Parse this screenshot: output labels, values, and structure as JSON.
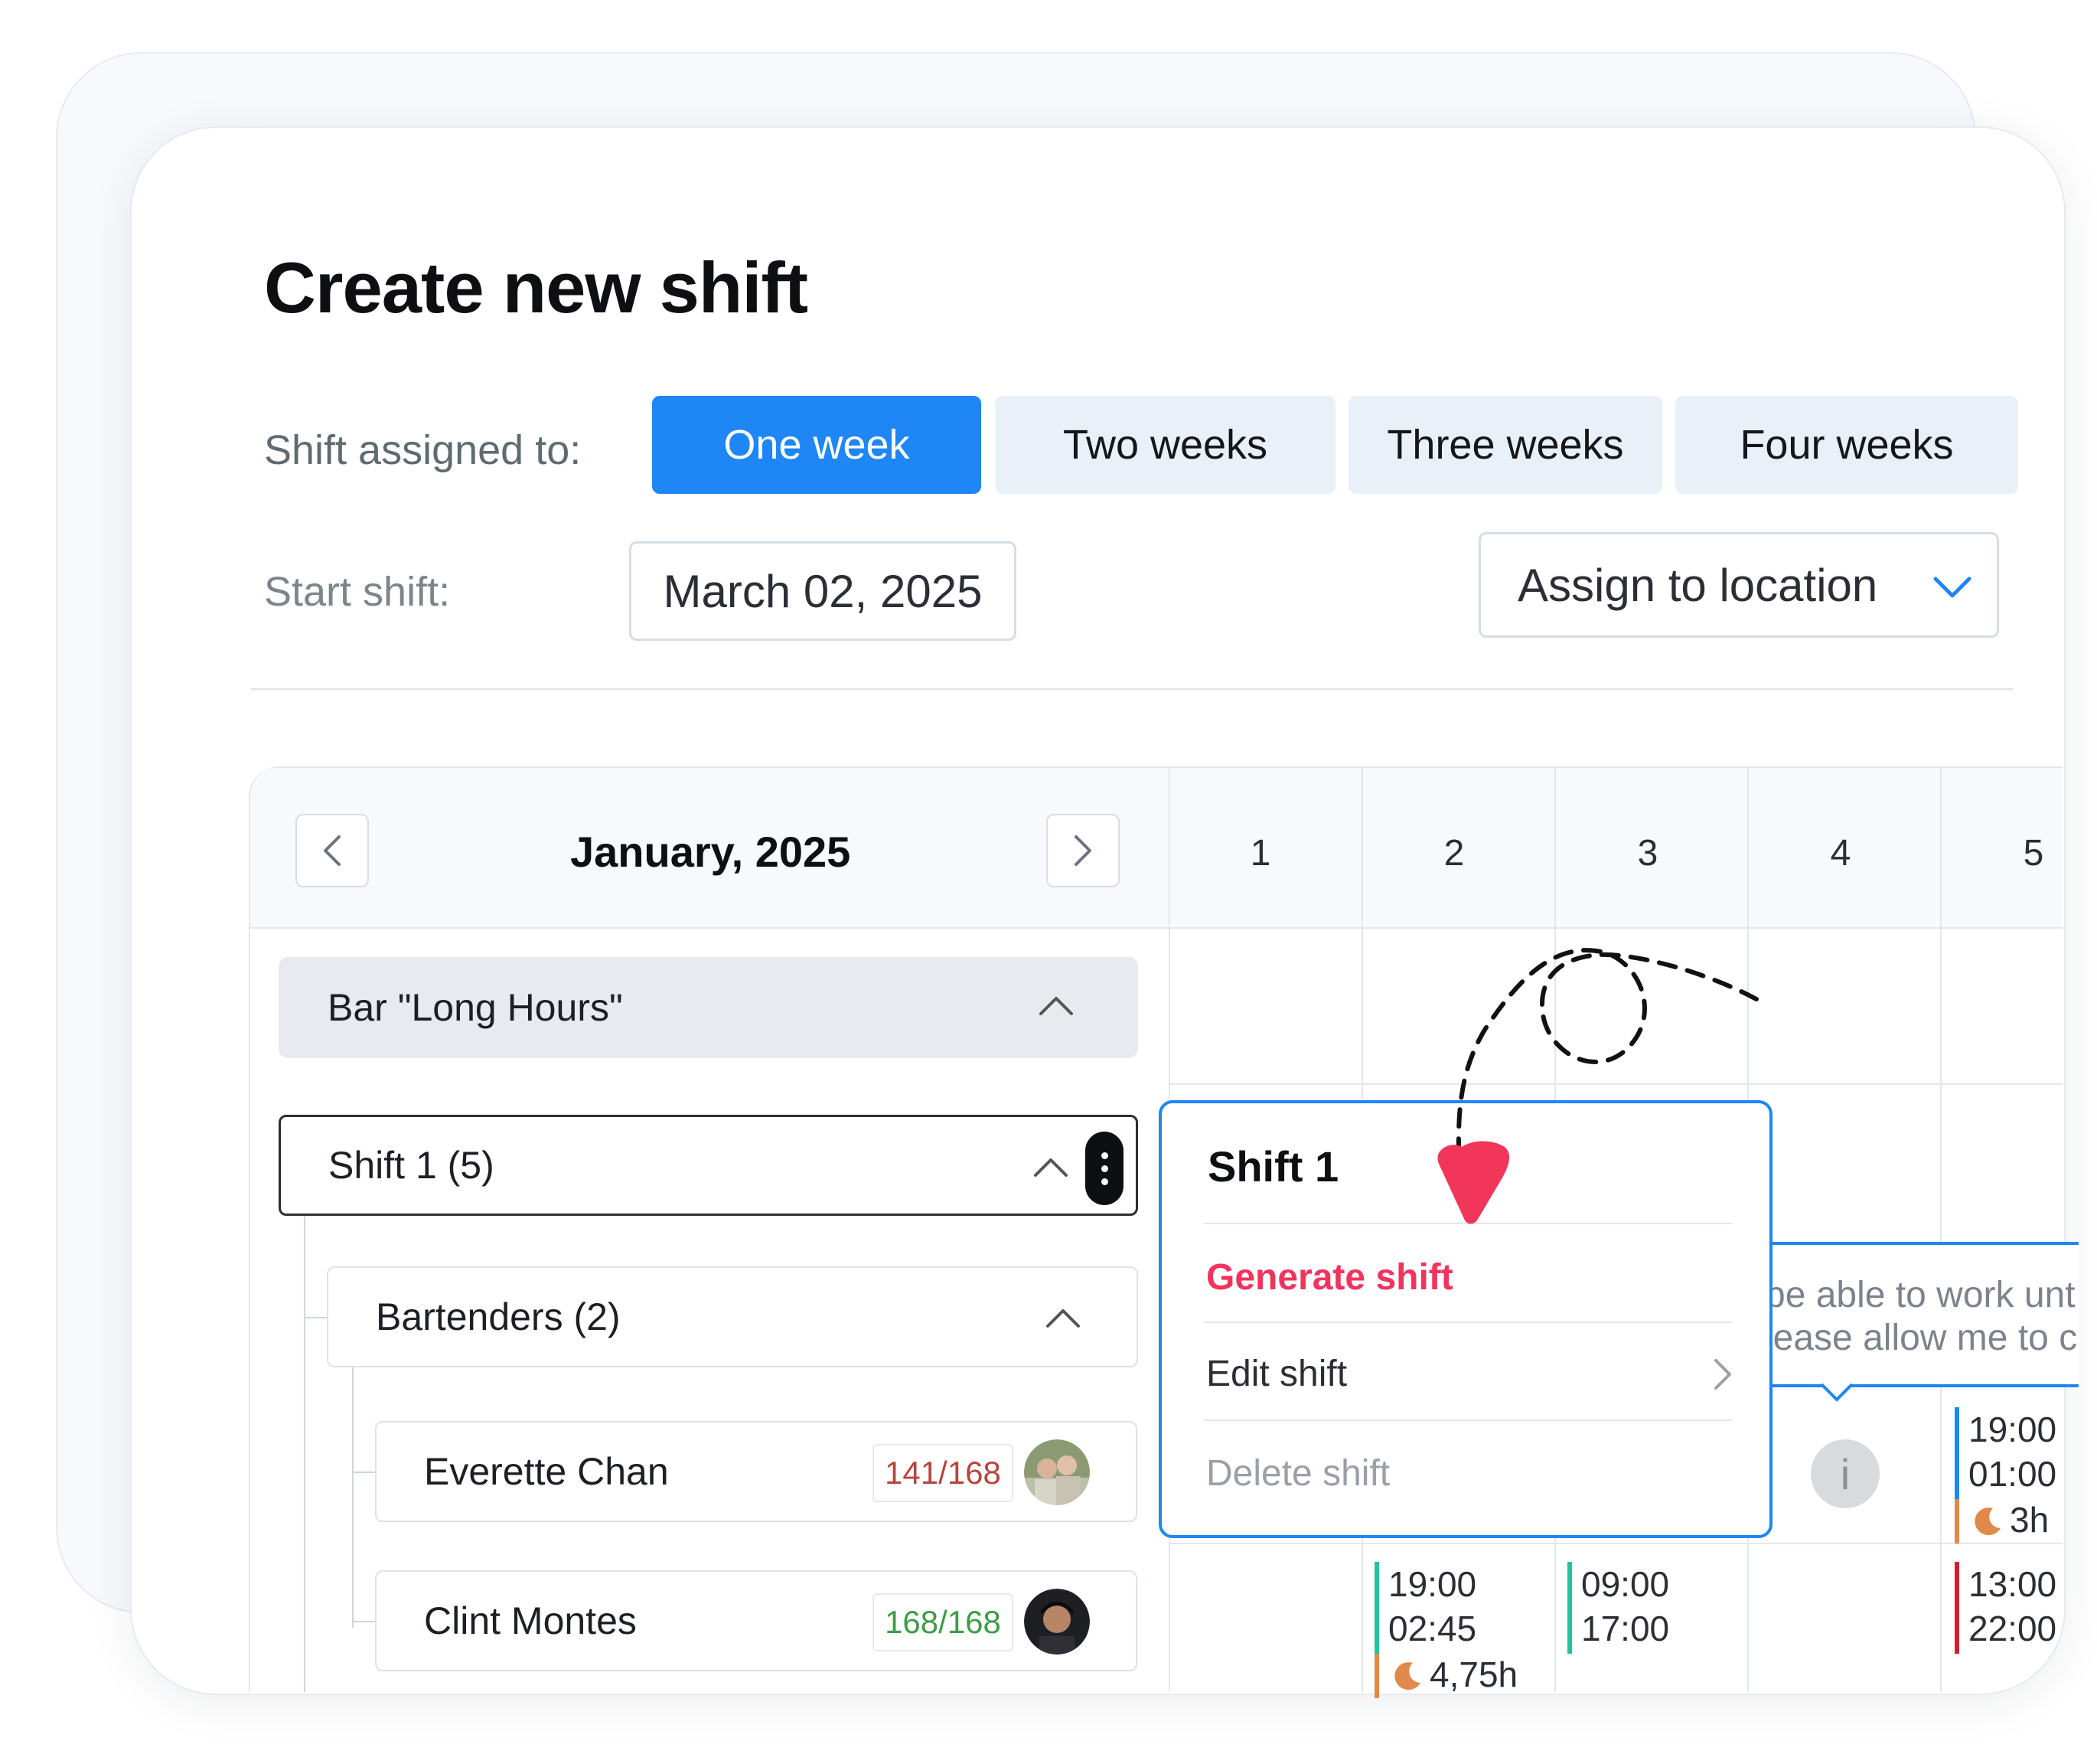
{
  "title": "Create new shift",
  "assigned_label": "Shift assigned to:",
  "periods": [
    "One week",
    "Two weeks",
    "Three weeks",
    "Four weeks"
  ],
  "start_label": "Start shift:",
  "start_date": "March 02, 2025",
  "location_placeholder": "Assign to location",
  "calendar": {
    "month": "January, 2025",
    "days": [
      "1",
      "2",
      "3",
      "4",
      "5"
    ]
  },
  "tree": {
    "location": "Bar \"Long Hours\"",
    "shift": "Shift 1 (5)",
    "role": "Bartenders (2)",
    "people": [
      {
        "name": "Everette Chan",
        "hours": "141/168",
        "hours_color": "#b4463e"
      },
      {
        "name": "Clint Montes",
        "hours": "168/168",
        "hours_color": "#3f9b45"
      }
    ]
  },
  "popover": {
    "title": "Shift 1",
    "generate": "Generate shift",
    "edit": "Edit shift",
    "delete": "Delete shift"
  },
  "tooltip": {
    "line1": "be able to work unt",
    "line2": "lease allow me to c"
  },
  "info_icon": "i",
  "entries": {
    "day5_row1": {
      "start": "19:00",
      "end": "01:00",
      "night": "3h"
    },
    "day2_row2": {
      "start": "19:00",
      "end": "02:45",
      "night": "4,75h"
    },
    "day3_row2": {
      "start": "09:00",
      "end": "17:00"
    },
    "day5_row2": {
      "start": "13:00",
      "end": "22:00"
    }
  },
  "colors": {
    "accent": "#1e86f5",
    "danger": "#f0345e",
    "green": "#22c39a",
    "orange": "#e0894a",
    "red": "#d0202a"
  }
}
